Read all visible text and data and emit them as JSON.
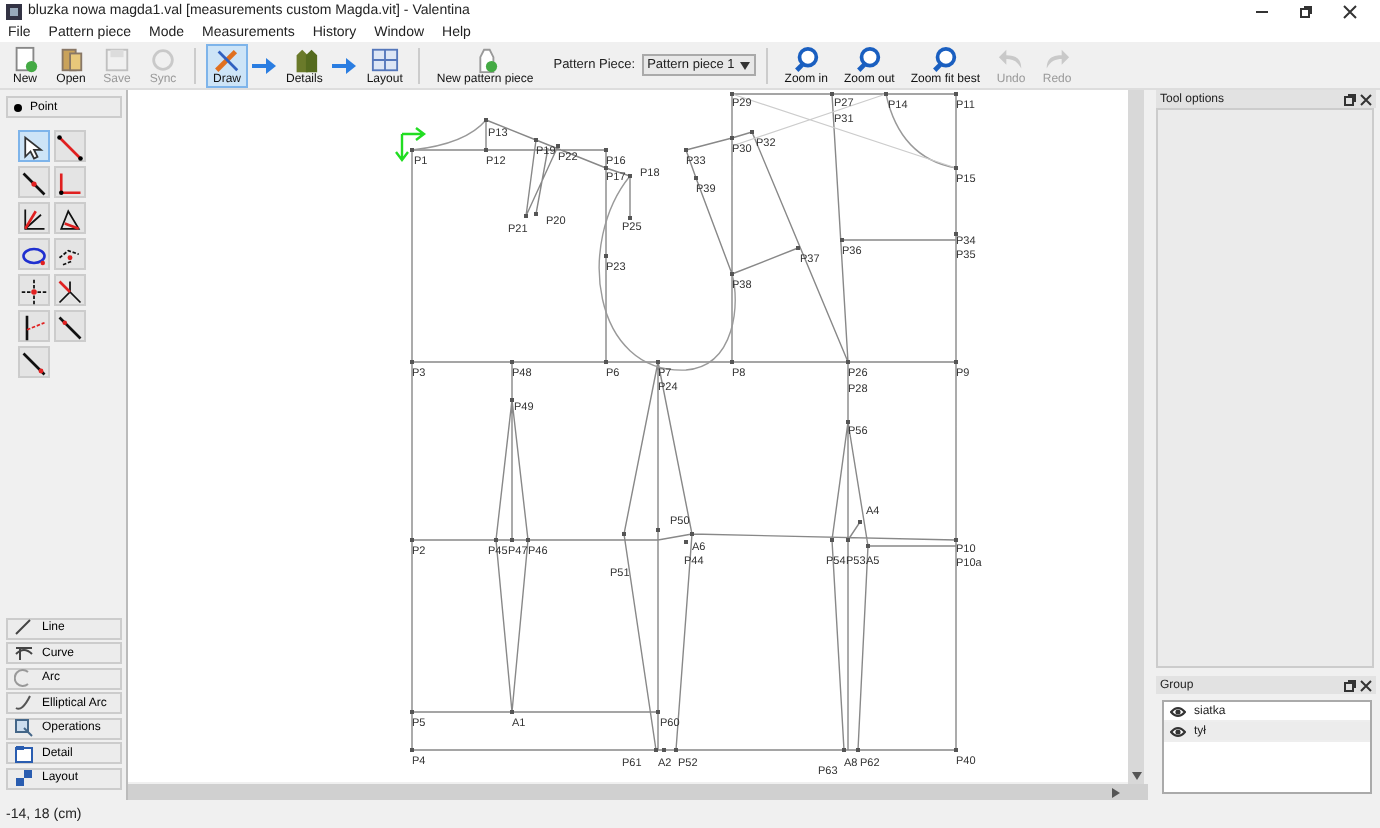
{
  "window": {
    "title": "bluzka nowa magda1.val [measurements custom Magda.vit] - Valentina"
  },
  "menu": [
    "File",
    "Pattern piece",
    "Mode",
    "Measurements",
    "History",
    "Window",
    "Help"
  ],
  "toolbar": {
    "file_buttons": [
      {
        "kind": "new",
        "label": "New",
        "disabled": false
      },
      {
        "kind": "open",
        "label": "Open",
        "disabled": false
      },
      {
        "kind": "save",
        "label": "Save",
        "disabled": true
      },
      {
        "kind": "sync",
        "label": "Sync",
        "disabled": true
      }
    ],
    "mode_buttons": [
      {
        "kind": "draw",
        "label": "Draw",
        "selected": true
      },
      {
        "kind": "details",
        "label": "Details",
        "selected": false
      },
      {
        "kind": "layout",
        "label": "Layout",
        "selected": false
      }
    ],
    "new_piece": "New pattern piece",
    "piece_label": "Pattern Piece:",
    "piece_value": "Pattern piece 1",
    "view_buttons": [
      {
        "kind": "zoom",
        "label": "Zoom in",
        "disabled": false
      },
      {
        "kind": "zoom",
        "label": "Zoom out",
        "disabled": false
      },
      {
        "kind": "zoom",
        "label": "Zoom fit best",
        "disabled": false
      },
      {
        "kind": "undo",
        "label": "Undo",
        "disabled": true
      },
      {
        "kind": "redo",
        "label": "Redo",
        "disabled": true
      }
    ]
  },
  "tool_panel": {
    "point_group": "Point",
    "tools": [
      {
        "selected": true
      },
      {
        "selected": false
      },
      {
        "selected": false
      },
      {
        "selected": false
      },
      {
        "selected": false
      },
      {
        "selected": false
      },
      {
        "selected": false
      },
      {
        "selected": false
      },
      {
        "selected": false
      },
      {
        "selected": false
      },
      {
        "selected": false
      },
      {
        "selected": false
      },
      {
        "selected": false
      }
    ],
    "groups": [
      "Line",
      "Curve",
      "Arc",
      "Elliptical Arc",
      "Operations",
      "Detail",
      "Layout"
    ]
  },
  "canvas": {
    "points": [
      {
        "label": "P1"
      },
      {
        "label": "P13"
      },
      {
        "label": "P12"
      },
      {
        "label": "P19"
      },
      {
        "label": "P22"
      },
      {
        "label": "P16"
      },
      {
        "label": "P17"
      },
      {
        "label": "P18"
      },
      {
        "label": "P21"
      },
      {
        "label": "P20"
      },
      {
        "label": "P25"
      },
      {
        "label": "P23"
      },
      {
        "label": "P33"
      },
      {
        "label": "P30"
      },
      {
        "label": "P32"
      },
      {
        "label": "P39"
      },
      {
        "label": "P29"
      },
      {
        "label": "P38"
      },
      {
        "label": "P37"
      },
      {
        "label": "P27"
      },
      {
        "label": "P31"
      },
      {
        "label": "P14"
      },
      {
        "label": "P11"
      },
      {
        "label": "P15"
      },
      {
        "label": "P34"
      },
      {
        "label": "P35"
      },
      {
        "label": "P36"
      },
      {
        "label": "P3"
      },
      {
        "label": "P48"
      },
      {
        "label": "P6"
      },
      {
        "label": "P7"
      },
      {
        "label": "P24"
      },
      {
        "label": "P8"
      },
      {
        "label": "P26"
      },
      {
        "label": "P28"
      },
      {
        "label": "P9"
      },
      {
        "label": "P49"
      },
      {
        "label": "P56"
      },
      {
        "label": "P50"
      },
      {
        "label": "A4"
      },
      {
        "label": "A6"
      },
      {
        "label": "P2"
      },
      {
        "label": "P45"
      },
      {
        "label": "P47"
      },
      {
        "label": "P46"
      },
      {
        "label": "P51"
      },
      {
        "label": "P44"
      },
      {
        "label": "P54"
      },
      {
        "label": "P53"
      },
      {
        "label": "A5"
      },
      {
        "label": "P10"
      },
      {
        "label": "P10a"
      },
      {
        "label": "P5"
      },
      {
        "label": "A1"
      },
      {
        "label": "P60"
      },
      {
        "label": "P4"
      },
      {
        "label": "P61"
      },
      {
        "label": "A2"
      },
      {
        "label": "P52"
      },
      {
        "label": "P63"
      },
      {
        "label": "A8"
      },
      {
        "label": "P62"
      },
      {
        "label": "P40"
      }
    ]
  },
  "tool_options": {
    "title": "Tool options"
  },
  "group_panel": {
    "title": "Group",
    "items": [
      {
        "name": "siatka",
        "selected": false
      },
      {
        "name": "tył",
        "selected": true
      }
    ]
  },
  "status_bar": "-14, 18 (cm)"
}
